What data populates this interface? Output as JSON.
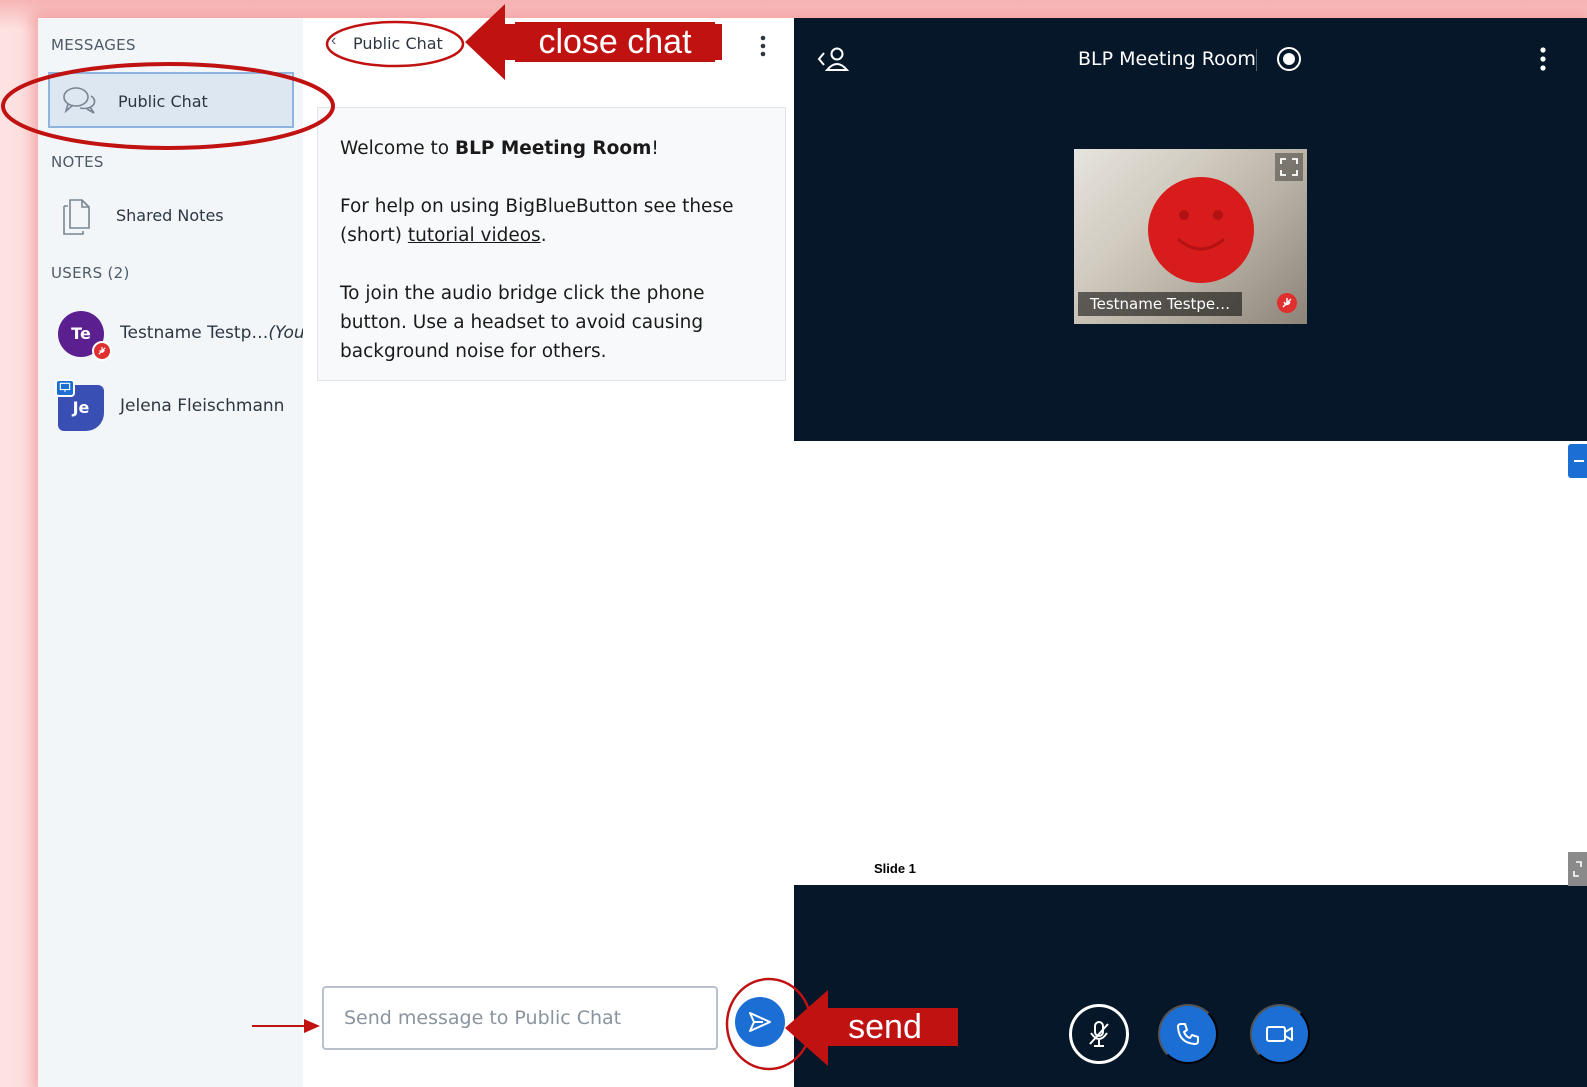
{
  "sidebar": {
    "messages_label": "MESSAGES",
    "public_chat_label": "Public Chat",
    "notes_label": "NOTES",
    "shared_notes_label": "Shared Notes",
    "users_label": "USERS (2)",
    "users": [
      {
        "initials": "Te",
        "name": "Testname Testp…",
        "suffix": "(You)",
        "color": "#5b1f8f"
      },
      {
        "initials": "Je",
        "name": "Jelena Fleischmann",
        "suffix": "",
        "color": "#3a4fb3"
      }
    ]
  },
  "chat": {
    "title": "Public Chat",
    "welcome": {
      "prefix": "Welcome to ",
      "room": "BLP Meeting Room",
      "suffix": "!",
      "help_text": "For help on using BigBlueButton see these (short) ",
      "help_link": "tutorial videos",
      "help_end": ".",
      "audio_text": "To join the audio bridge click the phone button. Use a headset to avoid causing background noise for others."
    },
    "input_placeholder": "Send message to Public Chat"
  },
  "media": {
    "room_title": "BLP Meeting Room",
    "webcam_name": "Testname Testpe…",
    "slide_label": "Slide 1"
  },
  "annotations": {
    "close_chat": "close chat",
    "send": "send",
    "color": "#c11212"
  },
  "icons": {
    "chat_bubbles": "chat-bubbles-icon",
    "notes": "document-icon",
    "back": "chevron-left-icon",
    "menu": "vertical-dots-icon",
    "users": "user-toggle-icon",
    "record": "record-icon",
    "send": "send-arrow-icon",
    "mic": "mic-muted-icon",
    "phone": "phone-icon",
    "camera": "camera-icon"
  },
  "colors": {
    "primary": "#1b6ed3",
    "dark_bg": "#06172a",
    "sidebar_bg": "#f3f6f9",
    "muted": "#e02f2f"
  }
}
